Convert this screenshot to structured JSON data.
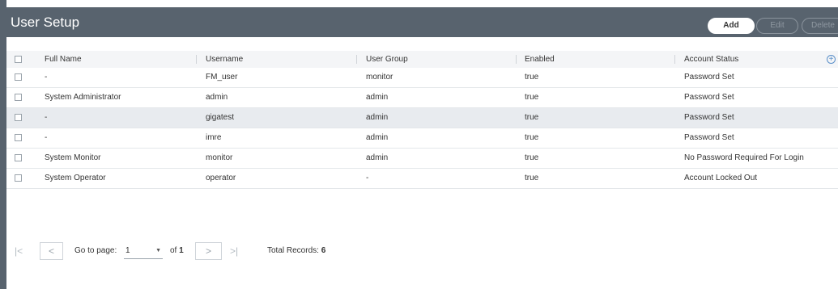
{
  "header": {
    "title": "User Setup",
    "add_label": "Add",
    "edit_label": "Edit",
    "delete_label": "Delete"
  },
  "table": {
    "columns": [
      "Full Name",
      "Username",
      "User Group",
      "Enabled",
      "Account Status"
    ],
    "rows": [
      {
        "full_name": "-",
        "username": "FM_user",
        "user_group": "monitor",
        "enabled": "true",
        "status": "Password Set"
      },
      {
        "full_name": "System Administrator",
        "username": "admin",
        "user_group": "admin",
        "enabled": "true",
        "status": "Password Set"
      },
      {
        "full_name": "-",
        "username": "gigatest",
        "user_group": "admin",
        "enabled": "true",
        "status": "Password Set"
      },
      {
        "full_name": "-",
        "username": "imre",
        "user_group": "admin",
        "enabled": "true",
        "status": "Password Set"
      },
      {
        "full_name": "System Monitor",
        "username": "monitor",
        "user_group": "admin",
        "enabled": "true",
        "status": "No Password Required For Login"
      },
      {
        "full_name": "System Operator",
        "username": "operator",
        "user_group": "-",
        "enabled": "true",
        "status": "Account Locked Out"
      }
    ]
  },
  "pager": {
    "first_icon": "first-page-icon",
    "prev_icon": "prev-page-icon",
    "next_icon": "next-page-icon",
    "last_icon": "last-page-icon",
    "go_to_label": "Go to page:",
    "page_value": "1",
    "of_label": "of",
    "total_pages": "1",
    "total_label": "Total Records:",
    "total_records": "6"
  },
  "colors": {
    "header_bg": "#58636e",
    "selected_row_bg": "#e8ebef",
    "accent": "#5a8fc9"
  }
}
